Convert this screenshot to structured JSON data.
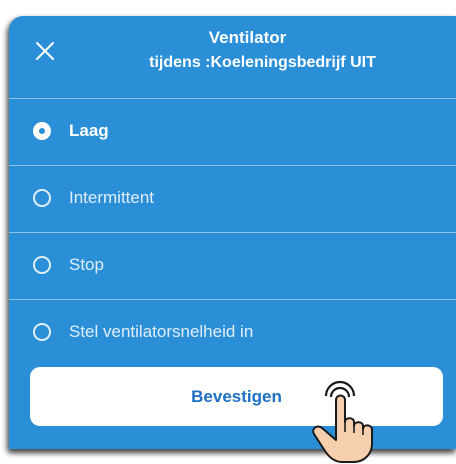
{
  "dialog": {
    "title": "Ventilator",
    "subtitle": "tijdens :Koeleningsbedrijf UIT",
    "close_icon": "close-icon"
  },
  "options": [
    {
      "label": "Laag",
      "selected": true
    },
    {
      "label": "Intermittent",
      "selected": false
    },
    {
      "label": "Stop",
      "selected": false
    },
    {
      "label": "Stel ventilatorsnelheid in",
      "selected": false
    }
  ],
  "confirm": {
    "label": "Bevestigen"
  },
  "pointer": {
    "icon": "tap-hand-icon"
  },
  "colors": {
    "dialog_bg": "#2b8fd8",
    "button_text": "#1f6fc4",
    "hand_skin": "#f5cfae"
  }
}
